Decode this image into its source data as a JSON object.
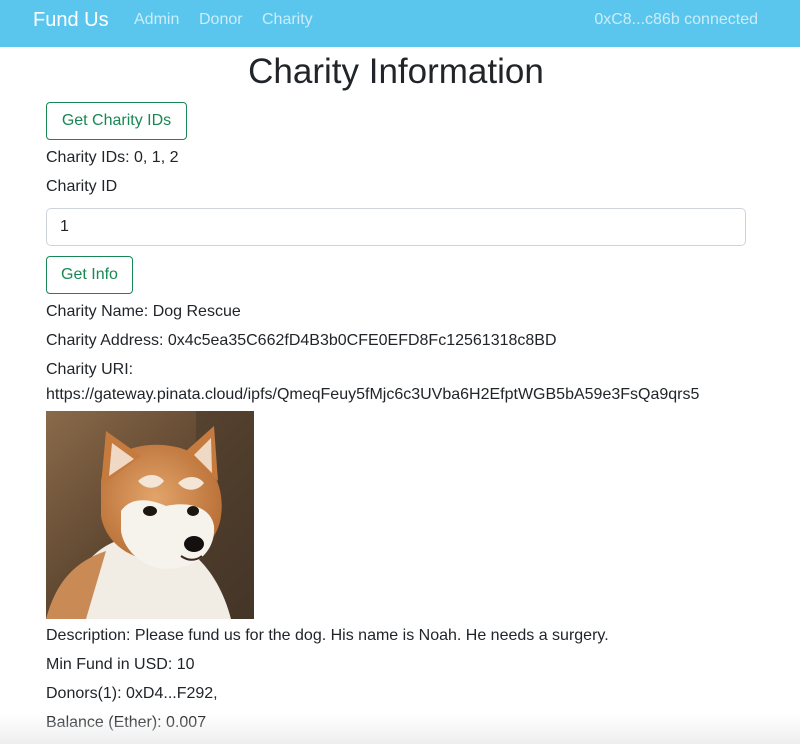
{
  "navbar": {
    "brand": "Fund Us",
    "links": [
      "Admin",
      "Donor",
      "Charity"
    ],
    "account": "0xC8...c86b connected",
    "bg_color": "#5bc6ed"
  },
  "page": {
    "title": "Charity Information"
  },
  "actions": {
    "get_ids_label": "Get Charity IDs",
    "get_info_label": "Get Info",
    "accent_color": "#198754"
  },
  "charity_ids_text": "Charity IDs: 0, 1, 2",
  "charity_id_field": {
    "label": "Charity ID",
    "value": "1"
  },
  "info": {
    "name": "Charity Name: Dog Rescue",
    "address": "Charity Address: 0x4c5ea35C662fD4B3b0CFE0EFD8Fc12561318c8BD",
    "uri_label": "Charity URI:",
    "uri": "https://gateway.pinata.cloud/ipfs/QmeqFeuy5fMjc6c3UVba6H2EfptWGB5bA59e3FsQa9qrs5",
    "image_subject": "shiba-inu-dog-photo",
    "description": "Description: Please fund us for the dog. His name is Noah. He needs a surgery.",
    "min_fund": "Min Fund in USD: 10",
    "donors": "Donors(1): 0xD4...F292,",
    "balance": "Balance (Ether): 0.007"
  }
}
